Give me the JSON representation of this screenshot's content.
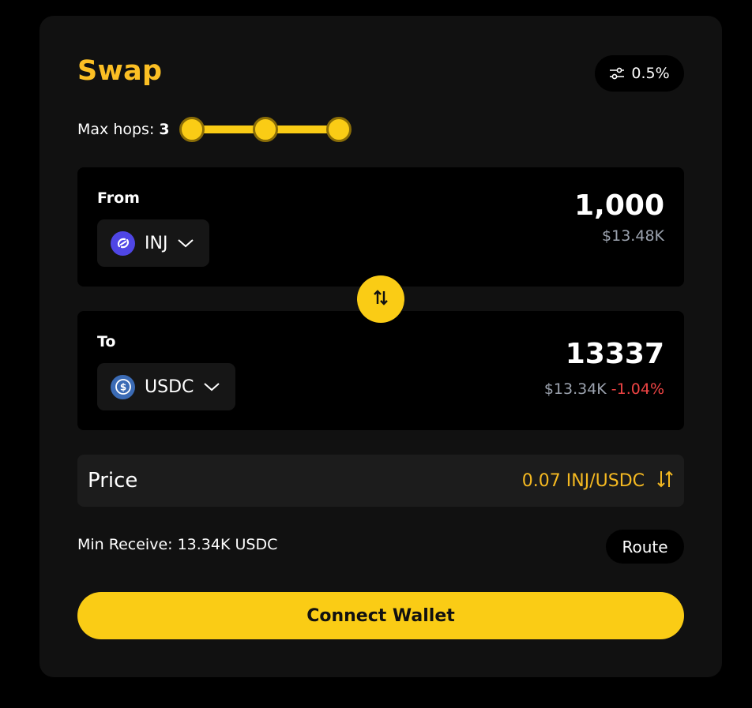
{
  "swap": {
    "title": "Swap",
    "slippage": "0.5%",
    "max_hops_label": "Max hops:",
    "max_hops_value": "3",
    "max_hops_level": 3,
    "max_hops_max": 3
  },
  "from": {
    "label": "From",
    "token": "INJ",
    "amount": "1,000",
    "usd_value": "$13.48K",
    "icon": "injective-icon"
  },
  "to": {
    "label": "To",
    "token": "USDC",
    "amount": "13337",
    "usd_value": "$13.34K",
    "price_impact": "-1.04%",
    "icon": "usdc-icon"
  },
  "price": {
    "label": "Price",
    "value": "0.07 INJ/USDC"
  },
  "min_receive": "Min Receive: 13.34K USDC",
  "route_label": "Route",
  "connect_label": "Connect Wallet",
  "colors": {
    "accent": "#facc15",
    "title": "#fbbf24",
    "negative": "#ef4444",
    "price": "#f5b921"
  }
}
